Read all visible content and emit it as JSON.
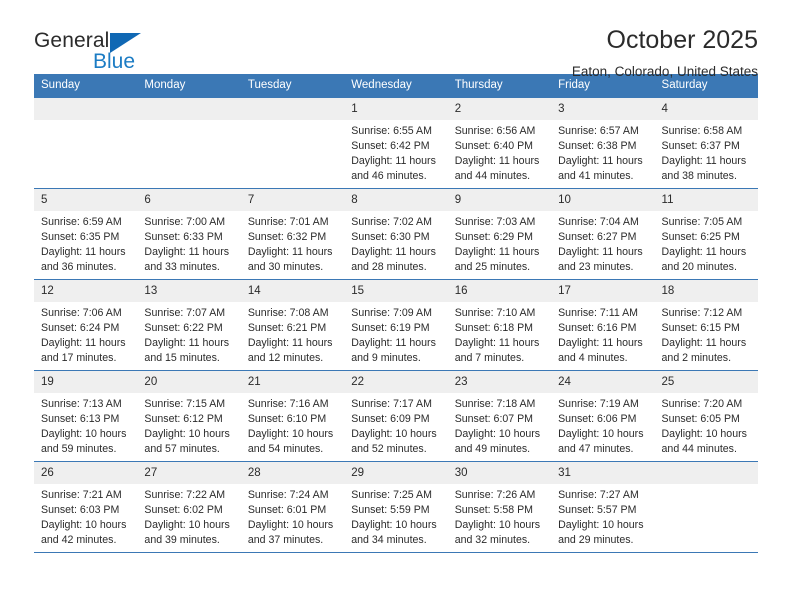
{
  "brand": {
    "name_top": "General",
    "name_bottom": "Blue",
    "accent_color": "#1068b4"
  },
  "header": {
    "title": "October 2025",
    "location": "Eaton, Colorado, United States"
  },
  "theme": {
    "header_blue": "#3b78b5",
    "date_band": "#efefef"
  },
  "calendar": {
    "weekday_headers": [
      "Sunday",
      "Monday",
      "Tuesday",
      "Wednesday",
      "Thursday",
      "Friday",
      "Saturday"
    ],
    "weeks": [
      [
        {
          "day": "",
          "sunrise": "",
          "sunset": "",
          "daylight1": "",
          "daylight2": "",
          "empty": true
        },
        {
          "day": "",
          "sunrise": "",
          "sunset": "",
          "daylight1": "",
          "daylight2": "",
          "empty": true
        },
        {
          "day": "",
          "sunrise": "",
          "sunset": "",
          "daylight1": "",
          "daylight2": "",
          "empty": true
        },
        {
          "day": "1",
          "sunrise": "Sunrise: 6:55 AM",
          "sunset": "Sunset: 6:42 PM",
          "daylight1": "Daylight: 11 hours",
          "daylight2": "and 46 minutes."
        },
        {
          "day": "2",
          "sunrise": "Sunrise: 6:56 AM",
          "sunset": "Sunset: 6:40 PM",
          "daylight1": "Daylight: 11 hours",
          "daylight2": "and 44 minutes."
        },
        {
          "day": "3",
          "sunrise": "Sunrise: 6:57 AM",
          "sunset": "Sunset: 6:38 PM",
          "daylight1": "Daylight: 11 hours",
          "daylight2": "and 41 minutes."
        },
        {
          "day": "4",
          "sunrise": "Sunrise: 6:58 AM",
          "sunset": "Sunset: 6:37 PM",
          "daylight1": "Daylight: 11 hours",
          "daylight2": "and 38 minutes."
        }
      ],
      [
        {
          "day": "5",
          "sunrise": "Sunrise: 6:59 AM",
          "sunset": "Sunset: 6:35 PM",
          "daylight1": "Daylight: 11 hours",
          "daylight2": "and 36 minutes."
        },
        {
          "day": "6",
          "sunrise": "Sunrise: 7:00 AM",
          "sunset": "Sunset: 6:33 PM",
          "daylight1": "Daylight: 11 hours",
          "daylight2": "and 33 minutes."
        },
        {
          "day": "7",
          "sunrise": "Sunrise: 7:01 AM",
          "sunset": "Sunset: 6:32 PM",
          "daylight1": "Daylight: 11 hours",
          "daylight2": "and 30 minutes."
        },
        {
          "day": "8",
          "sunrise": "Sunrise: 7:02 AM",
          "sunset": "Sunset: 6:30 PM",
          "daylight1": "Daylight: 11 hours",
          "daylight2": "and 28 minutes."
        },
        {
          "day": "9",
          "sunrise": "Sunrise: 7:03 AM",
          "sunset": "Sunset: 6:29 PM",
          "daylight1": "Daylight: 11 hours",
          "daylight2": "and 25 minutes."
        },
        {
          "day": "10",
          "sunrise": "Sunrise: 7:04 AM",
          "sunset": "Sunset: 6:27 PM",
          "daylight1": "Daylight: 11 hours",
          "daylight2": "and 23 minutes."
        },
        {
          "day": "11",
          "sunrise": "Sunrise: 7:05 AM",
          "sunset": "Sunset: 6:25 PM",
          "daylight1": "Daylight: 11 hours",
          "daylight2": "and 20 minutes."
        }
      ],
      [
        {
          "day": "12",
          "sunrise": "Sunrise: 7:06 AM",
          "sunset": "Sunset: 6:24 PM",
          "daylight1": "Daylight: 11 hours",
          "daylight2": "and 17 minutes."
        },
        {
          "day": "13",
          "sunrise": "Sunrise: 7:07 AM",
          "sunset": "Sunset: 6:22 PM",
          "daylight1": "Daylight: 11 hours",
          "daylight2": "and 15 minutes."
        },
        {
          "day": "14",
          "sunrise": "Sunrise: 7:08 AM",
          "sunset": "Sunset: 6:21 PM",
          "daylight1": "Daylight: 11 hours",
          "daylight2": "and 12 minutes."
        },
        {
          "day": "15",
          "sunrise": "Sunrise: 7:09 AM",
          "sunset": "Sunset: 6:19 PM",
          "daylight1": "Daylight: 11 hours",
          "daylight2": "and 9 minutes."
        },
        {
          "day": "16",
          "sunrise": "Sunrise: 7:10 AM",
          "sunset": "Sunset: 6:18 PM",
          "daylight1": "Daylight: 11 hours",
          "daylight2": "and 7 minutes."
        },
        {
          "day": "17",
          "sunrise": "Sunrise: 7:11 AM",
          "sunset": "Sunset: 6:16 PM",
          "daylight1": "Daylight: 11 hours",
          "daylight2": "and 4 minutes."
        },
        {
          "day": "18",
          "sunrise": "Sunrise: 7:12 AM",
          "sunset": "Sunset: 6:15 PM",
          "daylight1": "Daylight: 11 hours",
          "daylight2": "and 2 minutes."
        }
      ],
      [
        {
          "day": "19",
          "sunrise": "Sunrise: 7:13 AM",
          "sunset": "Sunset: 6:13 PM",
          "daylight1": "Daylight: 10 hours",
          "daylight2": "and 59 minutes."
        },
        {
          "day": "20",
          "sunrise": "Sunrise: 7:15 AM",
          "sunset": "Sunset: 6:12 PM",
          "daylight1": "Daylight: 10 hours",
          "daylight2": "and 57 minutes."
        },
        {
          "day": "21",
          "sunrise": "Sunrise: 7:16 AM",
          "sunset": "Sunset: 6:10 PM",
          "daylight1": "Daylight: 10 hours",
          "daylight2": "and 54 minutes."
        },
        {
          "day": "22",
          "sunrise": "Sunrise: 7:17 AM",
          "sunset": "Sunset: 6:09 PM",
          "daylight1": "Daylight: 10 hours",
          "daylight2": "and 52 minutes."
        },
        {
          "day": "23",
          "sunrise": "Sunrise: 7:18 AM",
          "sunset": "Sunset: 6:07 PM",
          "daylight1": "Daylight: 10 hours",
          "daylight2": "and 49 minutes."
        },
        {
          "day": "24",
          "sunrise": "Sunrise: 7:19 AM",
          "sunset": "Sunset: 6:06 PM",
          "daylight1": "Daylight: 10 hours",
          "daylight2": "and 47 minutes."
        },
        {
          "day": "25",
          "sunrise": "Sunrise: 7:20 AM",
          "sunset": "Sunset: 6:05 PM",
          "daylight1": "Daylight: 10 hours",
          "daylight2": "and 44 minutes."
        }
      ],
      [
        {
          "day": "26",
          "sunrise": "Sunrise: 7:21 AM",
          "sunset": "Sunset: 6:03 PM",
          "daylight1": "Daylight: 10 hours",
          "daylight2": "and 42 minutes."
        },
        {
          "day": "27",
          "sunrise": "Sunrise: 7:22 AM",
          "sunset": "Sunset: 6:02 PM",
          "daylight1": "Daylight: 10 hours",
          "daylight2": "and 39 minutes."
        },
        {
          "day": "28",
          "sunrise": "Sunrise: 7:24 AM",
          "sunset": "Sunset: 6:01 PM",
          "daylight1": "Daylight: 10 hours",
          "daylight2": "and 37 minutes."
        },
        {
          "day": "29",
          "sunrise": "Sunrise: 7:25 AM",
          "sunset": "Sunset: 5:59 PM",
          "daylight1": "Daylight: 10 hours",
          "daylight2": "and 34 minutes."
        },
        {
          "day": "30",
          "sunrise": "Sunrise: 7:26 AM",
          "sunset": "Sunset: 5:58 PM",
          "daylight1": "Daylight: 10 hours",
          "daylight2": "and 32 minutes."
        },
        {
          "day": "31",
          "sunrise": "Sunrise: 7:27 AM",
          "sunset": "Sunset: 5:57 PM",
          "daylight1": "Daylight: 10 hours",
          "daylight2": "and 29 minutes."
        },
        {
          "day": "",
          "sunrise": "",
          "sunset": "",
          "daylight1": "",
          "daylight2": "",
          "empty": true
        }
      ]
    ]
  }
}
